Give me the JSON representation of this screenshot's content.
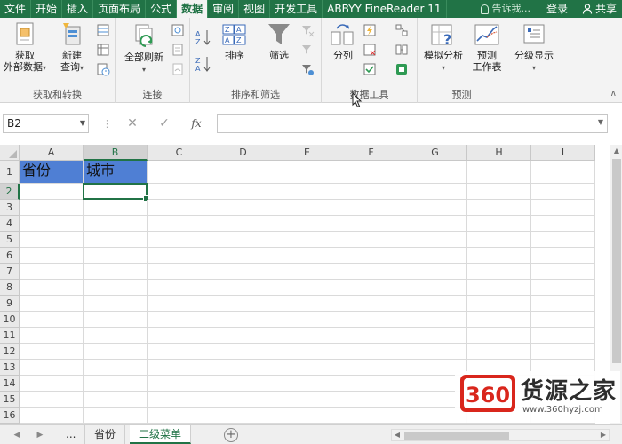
{
  "tabs": [
    {
      "label": "文件",
      "active": false
    },
    {
      "label": "开始",
      "active": false
    },
    {
      "label": "插入",
      "active": false
    },
    {
      "label": "页面布局",
      "active": false
    },
    {
      "label": "公式",
      "active": false
    },
    {
      "label": "数据",
      "active": true
    },
    {
      "label": "审阅",
      "active": false
    },
    {
      "label": "视图",
      "active": false
    },
    {
      "label": "开发工具",
      "active": false
    },
    {
      "label": "ABBYY FineReader 11",
      "active": false
    }
  ],
  "tell_me": "告诉我...",
  "login": "登录",
  "share": "共享",
  "ribbon": {
    "get_external": "获取\n外部数据",
    "new_query": "新建\n查询",
    "refresh_all": "全部刷新",
    "sort": "排序",
    "filter": "筛选",
    "text_to_columns": "分列",
    "what_if": "模拟分析",
    "forecast_sheet": "预测\n工作表",
    "outline": "分级显示",
    "groups": {
      "get_transform": "获取和转换",
      "connections": "连接",
      "sort_filter": "排序和筛选",
      "data_tools": "数据工具",
      "forecast": "预测"
    }
  },
  "formula_bar": {
    "name_box": "B2",
    "fx": "fx",
    "content": ""
  },
  "columns": [
    "A",
    "B",
    "C",
    "D",
    "E",
    "F",
    "G",
    "H",
    "I"
  ],
  "rows": [
    "1",
    "2",
    "3",
    "4",
    "5",
    "6",
    "7",
    "8",
    "9",
    "10",
    "11",
    "12",
    "13",
    "14",
    "15",
    "16"
  ],
  "cells": {
    "A1": "省份",
    "B1": "城市"
  },
  "selected_cell": "B2",
  "header_fill": "#4f7fd4",
  "accent": "#217346",
  "sheets": [
    {
      "label": "...",
      "active": false
    },
    {
      "label": "省份",
      "active": false
    },
    {
      "label": "二级菜单",
      "active": true
    }
  ],
  "watermark": {
    "logo_text": "360",
    "title": "货源之家",
    "url": "www.360hyzj.com"
  }
}
